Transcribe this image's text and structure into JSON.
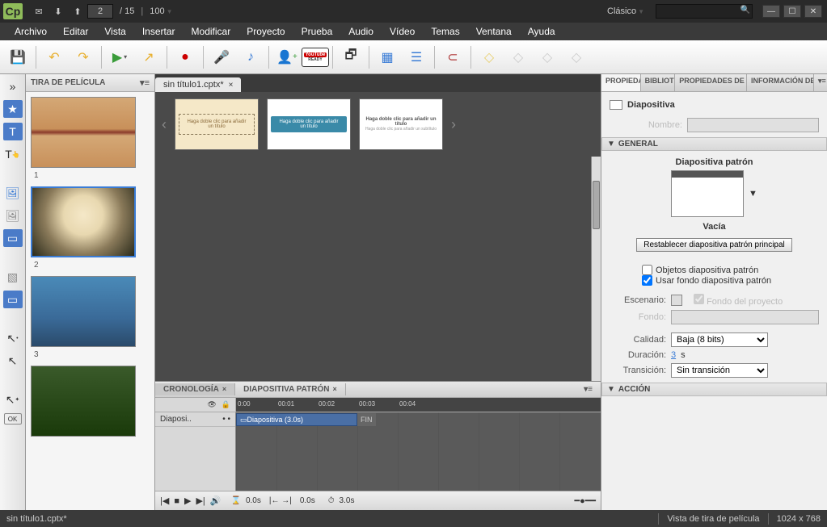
{
  "titlebar": {
    "page_current": "2",
    "page_total": "/  15",
    "zoom": "100",
    "workspace": "Clásico"
  },
  "menu": {
    "archivo": "Archivo",
    "editar": "Editar",
    "vista": "Vista",
    "insertar": "Insertar",
    "modificar": "Modificar",
    "proyecto": "Proyecto",
    "prueba": "Prueba",
    "audio": "Audio",
    "video": "Vídeo",
    "temas": "Temas",
    "ventana": "Ventana",
    "ayuda": "Ayuda"
  },
  "panels": {
    "filmstrip_title": "TIRA DE PELÍCULA",
    "slides": [
      {
        "num": "1"
      },
      {
        "num": "2"
      },
      {
        "num": "3"
      },
      {
        "num": ""
      }
    ]
  },
  "doc": {
    "tab_title": "sin título1.cptx*"
  },
  "timeline": {
    "tab_cronologia": "CRONOLOGÍA",
    "tab_patron": "DIAPOSITIVA PATRÓN",
    "layer_name": "Diaposi..",
    "clip_label": "Diapositiva (3.0s)",
    "end_label": "FIN",
    "ticks": [
      "0:00",
      "00:01",
      "00:02",
      "00:03",
      "00:04"
    ],
    "time_a": "0.0s",
    "time_b": "0.0s",
    "time_c": "3.0s"
  },
  "props": {
    "tabs": {
      "propiedades": "PROPIEDADES",
      "biblioteca": "BIBLIOTECA",
      "propiedades_prueba": "PROPIEDADES DE LAS PRUEB",
      "info_proyecto": "INFORMACIÓN DEL PROYEC"
    },
    "title_label": "Diapositiva",
    "nombre_label": "Nombre:",
    "general_section": "GENERAL",
    "master_slide_label": "Diapositiva patrón",
    "master_name": "Vacía",
    "reset_btn": "Restablecer diapositiva patrón principal",
    "objetos_check": "Objetos diapositiva patrón",
    "usar_fondo_check": "Usar fondo diapositiva patrón",
    "escenario_label": "Escenario:",
    "fondo_proyecto": "Fondo del proyecto",
    "fondo_label": "Fondo:",
    "calidad_label": "Calidad:",
    "calidad_value": "Baja (8 bits)",
    "duracion_label": "Duración:",
    "duracion_value": "3",
    "duracion_unit": " s",
    "transicion_label": "Transición:",
    "transicion_value": "Sin transición",
    "accion_section": "ACCIÓN"
  },
  "statusbar": {
    "file": "sin título1.cptx*",
    "view": "Vista de tira de película",
    "dims": "1024 x 768"
  },
  "yt": {
    "top": "YouTube",
    "bottom": "READY"
  }
}
